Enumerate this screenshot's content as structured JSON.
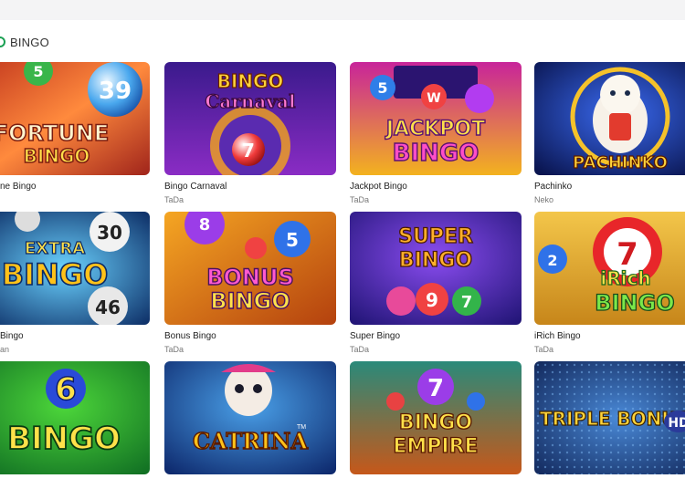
{
  "section": {
    "title": "BINGO",
    "icon": "bingo-icon"
  },
  "games": [
    {
      "name": "ne Bingo",
      "provider": "",
      "art": [
        "FORTUNE",
        "BINGO"
      ],
      "ball": "39",
      "ball2": "5"
    },
    {
      "name": "Bingo Carnaval",
      "provider": "TaDa",
      "art": [
        "BINGO",
        "Carnaval"
      ],
      "ball": "7",
      "ball2": ""
    },
    {
      "name": "Jackpot Bingo",
      "provider": "TaDa",
      "art": [
        "JACKPOT",
        "BINGO"
      ],
      "ball": "5",
      "ball2": "W"
    },
    {
      "name": "Pachinko",
      "provider": "Neko",
      "art": [
        "PACHINKO",
        ""
      ],
      "ball": "",
      "ball2": ""
    },
    {
      "name": "Bingo",
      "provider": "an",
      "art": [
        "EXTRA",
        "BINGO"
      ],
      "ball": "30",
      "ball2": "46"
    },
    {
      "name": "Bonus Bingo",
      "provider": "TaDa",
      "art": [
        "BONUS",
        "BINGO"
      ],
      "ball": "8",
      "ball2": "5"
    },
    {
      "name": "Super Bingo",
      "provider": "TaDa",
      "art": [
        "SUPER",
        "BINGO"
      ],
      "ball": "9",
      "ball2": "7"
    },
    {
      "name": "iRich Bingo",
      "provider": "TaDa",
      "art": [
        "iRich",
        "BINGO"
      ],
      "ball": "7",
      "ball2": "2"
    },
    {
      "name": "",
      "provider": "",
      "art": [
        "6",
        "BINGO"
      ],
      "ball": "",
      "ball2": ""
    },
    {
      "name": "",
      "provider": "",
      "art": [
        "CATRINA",
        "TM"
      ],
      "ball": "",
      "ball2": ""
    },
    {
      "name": "",
      "provider": "",
      "art": [
        "BINGO",
        "EMPIRE"
      ],
      "ball": "7",
      "ball2": ""
    },
    {
      "name": "",
      "provider": "",
      "art": [
        "TRIPLE BONUS",
        "HD"
      ],
      "ball": "",
      "ball2": ""
    }
  ],
  "colors": {
    "accent": "#1aa053",
    "text": "#222222",
    "muted": "#777777"
  }
}
